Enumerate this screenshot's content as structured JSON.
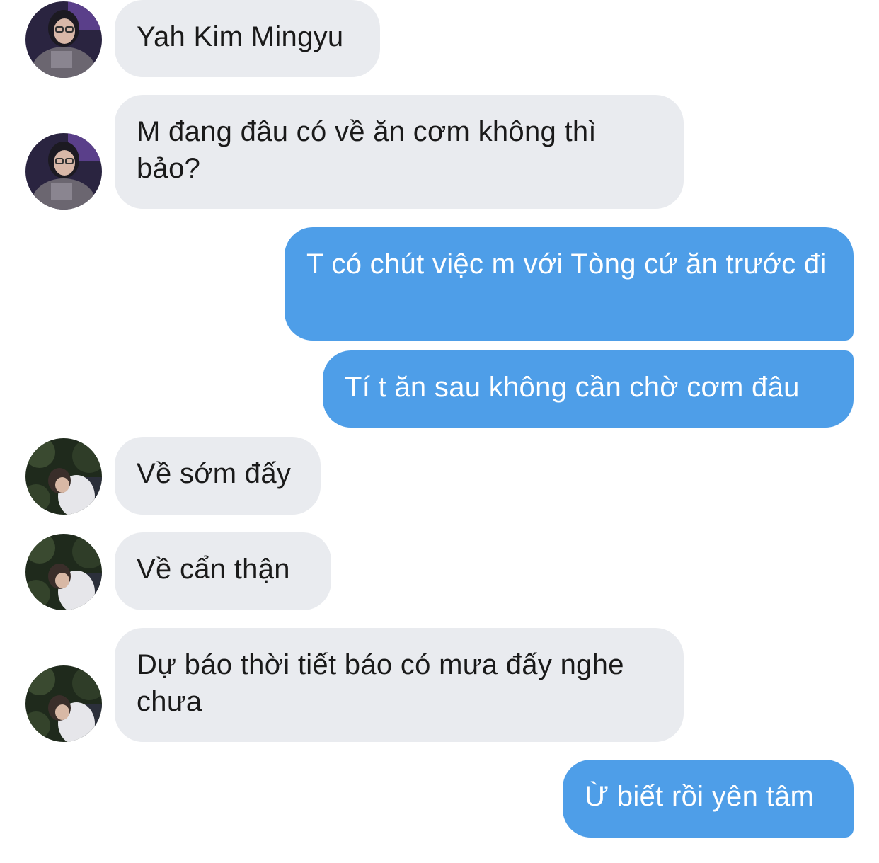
{
  "colors": {
    "incoming_bubble": "#e9ebef",
    "outgoing_bubble": "#4e9ee8",
    "incoming_text": "#1a1a1a",
    "outgoing_text": "#ffffff"
  },
  "messages": [
    {
      "direction": "incoming",
      "sender_avatar": "avatar-girl-glasses",
      "text": "Yah Kim Mingyu"
    },
    {
      "direction": "incoming",
      "sender_avatar": "avatar-girl-glasses",
      "text": "M đang đâu có về ăn cơm không thì bảo?"
    },
    {
      "direction": "outgoing",
      "text": "T có chút việc m với Tòng cứ ăn trước đi"
    },
    {
      "direction": "outgoing",
      "text": "Tí t ăn sau không cần chờ cơm đâu"
    },
    {
      "direction": "incoming",
      "sender_avatar": "avatar-boy-trees",
      "text": "Về sớm đấy"
    },
    {
      "direction": "incoming",
      "sender_avatar": "avatar-boy-trees",
      "text": "Về cẩn thận"
    },
    {
      "direction": "incoming",
      "sender_avatar": "avatar-boy-trees",
      "text": "Dự báo thời tiết báo có mưa đấy nghe chưa"
    },
    {
      "direction": "outgoing",
      "text": "Ừ biết rồi yên tâm"
    }
  ]
}
